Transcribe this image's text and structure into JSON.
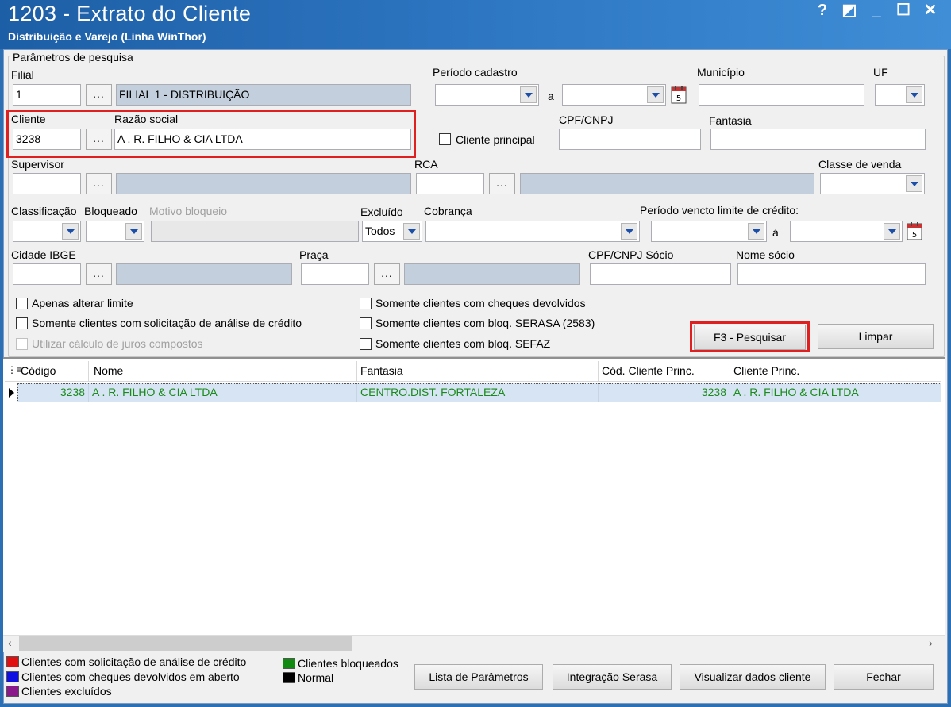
{
  "window": {
    "title": "1203 - Extrato do Cliente",
    "subtitle": "Distribuição e Varejo (Linha WinThor)",
    "controls": [
      "?",
      "◩",
      "_",
      "☐",
      "✕"
    ]
  },
  "params": {
    "group_label": "Parâmetros de pesquisa",
    "filial_label": "Filial",
    "filial_value": "1",
    "filial_name": "FILIAL 1 - DISTRIBUIÇÃO",
    "ellipsis": "...",
    "periodo_cadastro_label": "Período cadastro",
    "a_label": "a",
    "municipio_label": "Município",
    "uf_label": "UF",
    "cliente_label": "Cliente",
    "cliente_value": "3238",
    "razao_label": "Razão social",
    "razao_value": "A . R.  FILHO & CIA LTDA",
    "cliente_principal_label": "Cliente principal",
    "cpf_label": "CPF/CNPJ",
    "fantasia_label": "Fantasia",
    "supervisor_label": "Supervisor",
    "rca_label": "RCA",
    "classe_venda_label": "Classe de venda",
    "classificacao_label": "Classificação",
    "bloqueado_label": "Bloqueado",
    "motivo_label": "Motivo bloqueio",
    "excluido_label": "Excluído",
    "excluido_value": "Todos",
    "cobranca_label": "Cobrança",
    "periodo_vencto_label": "Período vencto limite de crédito:",
    "a2_label": "à",
    "cidade_ibge_label": "Cidade IBGE",
    "praca_label": "Praça",
    "cpf_socio_label": "CPF/CNPJ Sócio",
    "nome_socio_label": "Nome sócio",
    "chk_alterar_limite": "Apenas alterar limite",
    "chk_solicitacao": "Somente clientes com solicitação de análise de crédito",
    "chk_juros": "Utilizar cálculo de juros compostos",
    "chk_cheques": "Somente clientes com cheques devolvidos",
    "chk_serasa": "Somente clientes com bloq. SERASA (2583)",
    "chk_sefaz": "Somente clientes com bloq. SEFAZ",
    "pesquisar_label": "F3 - Pesquisar",
    "limpar_label": "Limpar"
  },
  "grid": {
    "headers": {
      "codigo": "Código",
      "nome": "Nome",
      "fantasia": "Fantasia",
      "cod_princ": "Cód. Cliente Princ.",
      "cliente_princ": "Cliente Princ."
    },
    "rows": [
      {
        "codigo": "3238",
        "nome": "A . R.  FILHO & CIA LTDA",
        "fantasia": "CENTRO.DIST. FORTALEZA",
        "cod_princ": "3238",
        "cliente_princ": "A . R.  FILHO & CIA LTDA"
      }
    ]
  },
  "legend": {
    "solicitacao": "Clientes com solicitação de análise de crédito",
    "cheques": "Clientes com cheques devolvidos em aberto",
    "excluidos": "Clientes excluídos",
    "bloqueados": "Clientes bloqueados",
    "normal": "Normal",
    "colors": {
      "solicitacao": "#e01010",
      "cheques": "#1010e0",
      "excluidos": "#8a1a8a",
      "bloqueados": "#108a10",
      "normal": "#000000"
    }
  },
  "footer": {
    "lista_label": "Lista de Parâmetros",
    "serasa_label": "Integração Serasa",
    "visualizar_label": "Visualizar dados cliente",
    "fechar_label": "Fechar"
  }
}
